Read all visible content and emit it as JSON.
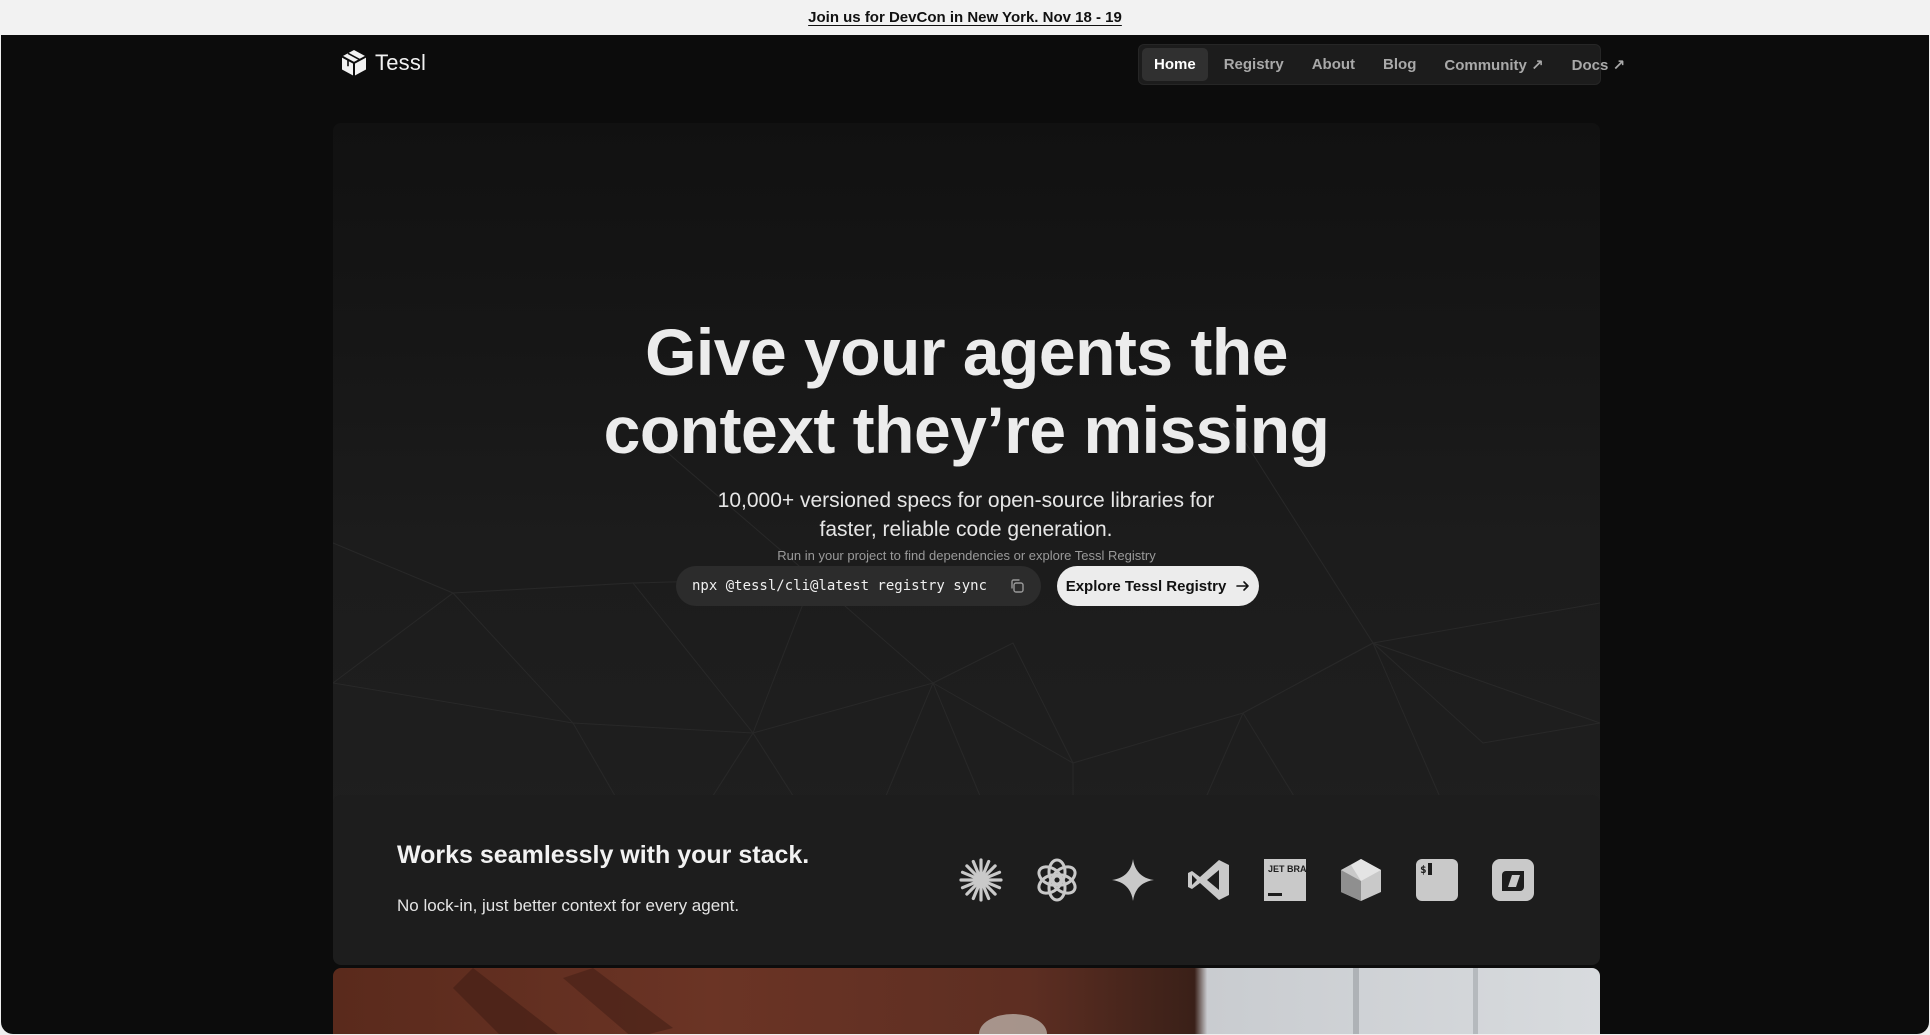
{
  "announcement": {
    "text": "Join us for DevCon in New York. Nov 18 - 19"
  },
  "brand": {
    "name": "Tessl",
    "logo_icon": "cube-logo-icon"
  },
  "nav": {
    "items": [
      {
        "label": "Home",
        "active": true
      },
      {
        "label": "Registry",
        "active": false
      },
      {
        "label": "About",
        "active": false
      },
      {
        "label": "Blog",
        "active": false
      },
      {
        "label": "Community ↗",
        "active": false
      },
      {
        "label": "Docs ↗",
        "active": false
      }
    ]
  },
  "hero": {
    "headline_line1": "Give your agents the",
    "headline_line2": "context they’re missing",
    "subhead_line1": "10,000+ versioned specs for open-source libraries for",
    "subhead_line2": "faster, reliable code generation.",
    "hint": "Run in your project to find dependencies or explore Tessl Registry",
    "command": "npx @tessl/cli@latest registry sync",
    "copy_icon": "copy-icon",
    "cta_label": "Explore Tessl Registry",
    "cta_icon": "arrow-right-icon"
  },
  "stack": {
    "title": "Works seamlessly with your stack.",
    "subtitle": "No lock-in, just better context for every agent.",
    "integrations": [
      "claude-icon",
      "openai-icon",
      "gemini-icon",
      "vscode-icon",
      "jetbrains-icon",
      "cursor-icon",
      "terminal-icon",
      "windsurf-icon"
    ],
    "jetbrains_label": "JET BRAINS"
  },
  "colors": {
    "background": "#0c0c0c",
    "panel": "#1d1d1d",
    "accent_button": "#ececec"
  }
}
